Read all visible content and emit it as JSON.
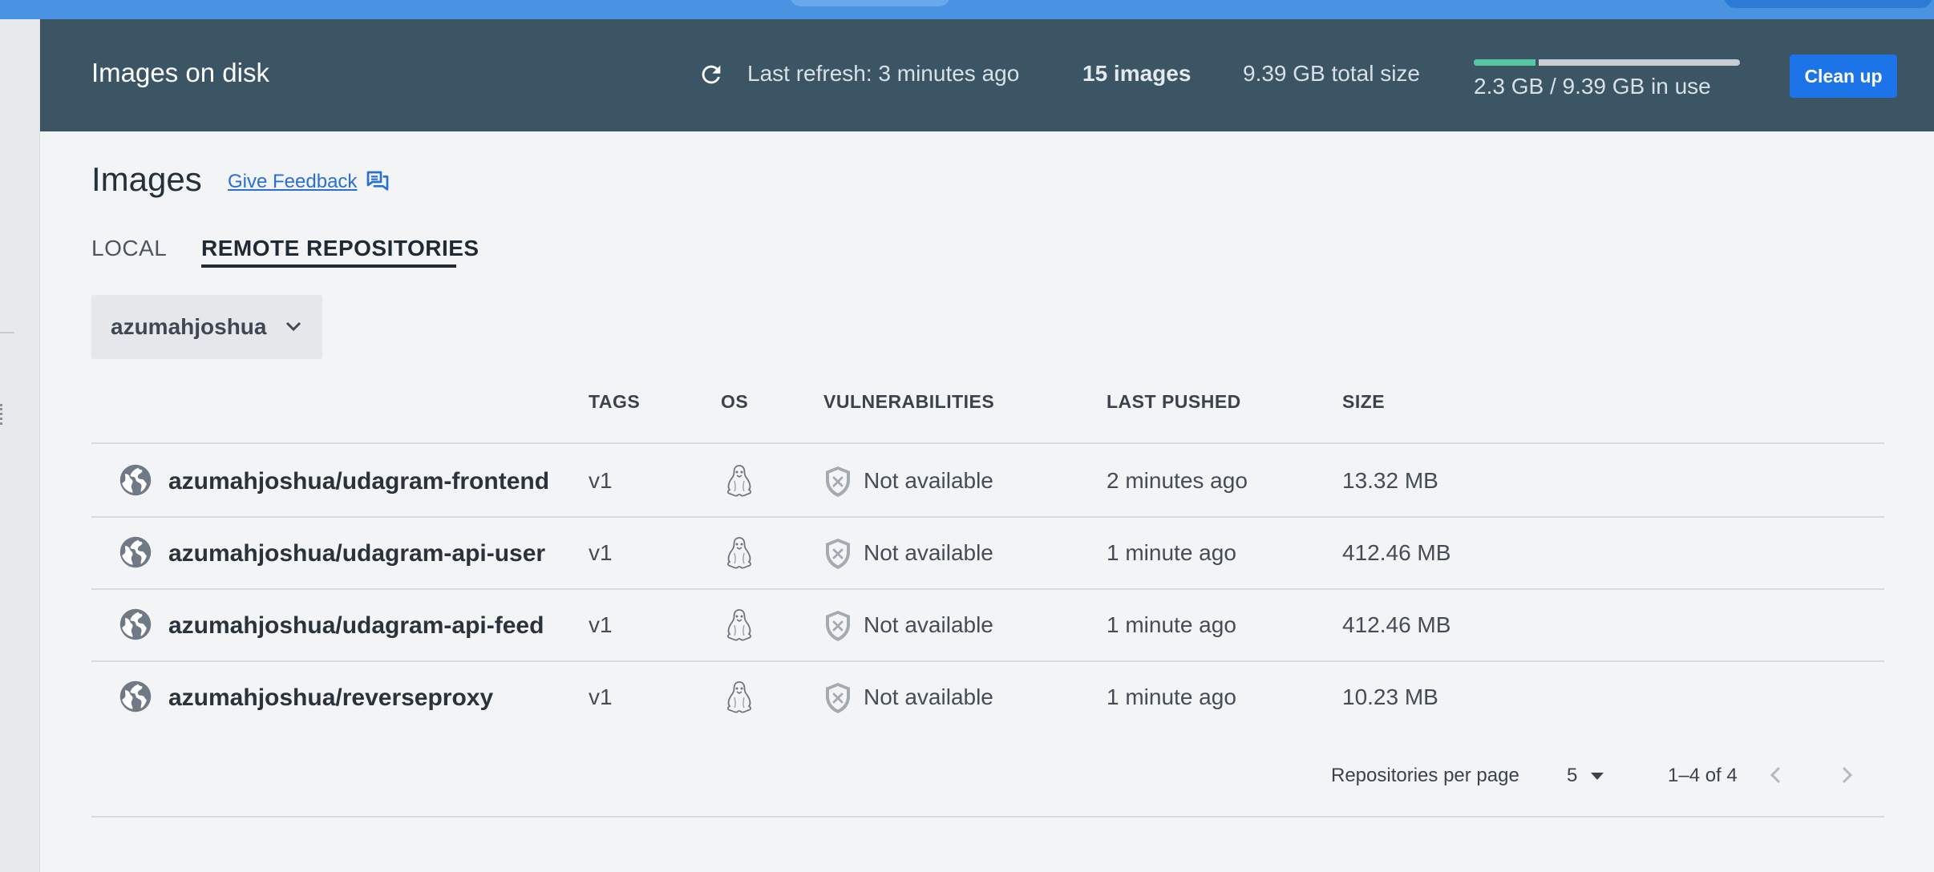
{
  "header": {
    "title": "Images on disk",
    "refresh_text": "Last refresh: 3 minutes ago",
    "image_count": "15 images",
    "total_size": "9.39 GB total size",
    "usage_text": "2.3 GB / 9.39 GB in use",
    "usage_fraction": 0.245,
    "cleanup_label": "Clean up",
    "refresh_icon": "refresh-icon"
  },
  "page": {
    "title": "Images",
    "feedback_label": "Give Feedback",
    "feedback_icon": "feedback-chat-icon"
  },
  "tabs": [
    {
      "label": "LOCAL",
      "active": false
    },
    {
      "label": "REMOTE REPOSITORIES",
      "active": true
    }
  ],
  "repo_selector": {
    "selected": "azumahjoshua"
  },
  "table": {
    "headers": {
      "tags": "TAGS",
      "os": "OS",
      "vulnerabilities": "VULNERABILITIES",
      "last_pushed": "LAST PUSHED",
      "size": "SIZE"
    },
    "rows": [
      {
        "name": "azumahjoshua/udagram-frontend",
        "tag": "v1",
        "os_icon": "linux-icon",
        "vulnerabilities": "Not available",
        "last_pushed": "2 minutes ago",
        "size": "13.32 MB"
      },
      {
        "name": "azumahjoshua/udagram-api-user",
        "tag": "v1",
        "os_icon": "linux-icon",
        "vulnerabilities": "Not available",
        "last_pushed": "1 minute ago",
        "size": "412.46 MB"
      },
      {
        "name": "azumahjoshua/udagram-api-feed",
        "tag": "v1",
        "os_icon": "linux-icon",
        "vulnerabilities": "Not available",
        "last_pushed": "1 minute ago",
        "size": "412.46 MB"
      },
      {
        "name": "azumahjoshua/reverseproxy",
        "tag": "v1",
        "os_icon": "linux-icon",
        "vulnerabilities": "Not available",
        "last_pushed": "1 minute ago",
        "size": "10.23 MB"
      }
    ]
  },
  "pagination": {
    "per_page_label": "Repositories per page",
    "per_page_value": "5",
    "range": "1–4 of 4"
  },
  "colors": {
    "header_bg": "#3c5564",
    "topbar": "#4a93e2",
    "primary_button": "#1d73e8",
    "usage_fill": "#55c7a5",
    "link": "#2a6fd6"
  }
}
